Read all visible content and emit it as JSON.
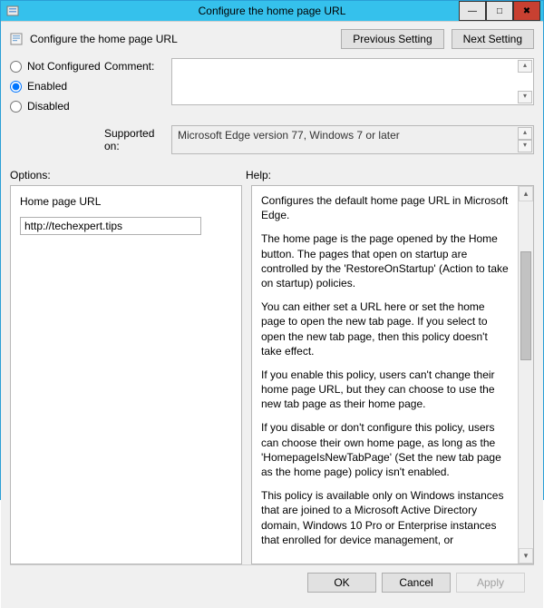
{
  "window": {
    "title": "Configure the home page URL"
  },
  "header": {
    "policy_title": "Configure the home page URL",
    "prev_btn": "Previous Setting",
    "next_btn": "Next Setting"
  },
  "state": {
    "not_configured": "Not Configured",
    "enabled": "Enabled",
    "disabled": "Disabled",
    "selected": "enabled"
  },
  "comment": {
    "label": "Comment:",
    "value": ""
  },
  "supported": {
    "label": "Supported on:",
    "value": "Microsoft Edge version 77, Windows 7 or later"
  },
  "panels": {
    "options_label": "Options:",
    "help_label": "Help:"
  },
  "options": {
    "field_label": "Home page URL",
    "field_value": "http://techexpert.tips"
  },
  "help": {
    "p1": "Configures the default home page URL in Microsoft Edge.",
    "p2": "The home page is the page opened by the Home button. The pages that open on startup are controlled by the 'RestoreOnStartup' (Action to take on startup) policies.",
    "p3": "You can either set a URL here or set the home page to open the new tab page. If you select to open the new tab page, then this policy doesn't take effect.",
    "p4": "If you enable this policy, users can't change their home page URL, but they can choose to use the new tab page as their home page.",
    "p5": "If you disable or don't configure this policy, users can choose their own home page, as long as the 'HomepageIsNewTabPage' (Set the new tab page as the home page) policy isn't enabled.",
    "p6": "This policy is available only on Windows instances that are joined to a Microsoft Active Directory domain, Windows 10 Pro or Enterprise instances that enrolled for device management, or"
  },
  "footer": {
    "ok": "OK",
    "cancel": "Cancel",
    "apply": "Apply"
  }
}
